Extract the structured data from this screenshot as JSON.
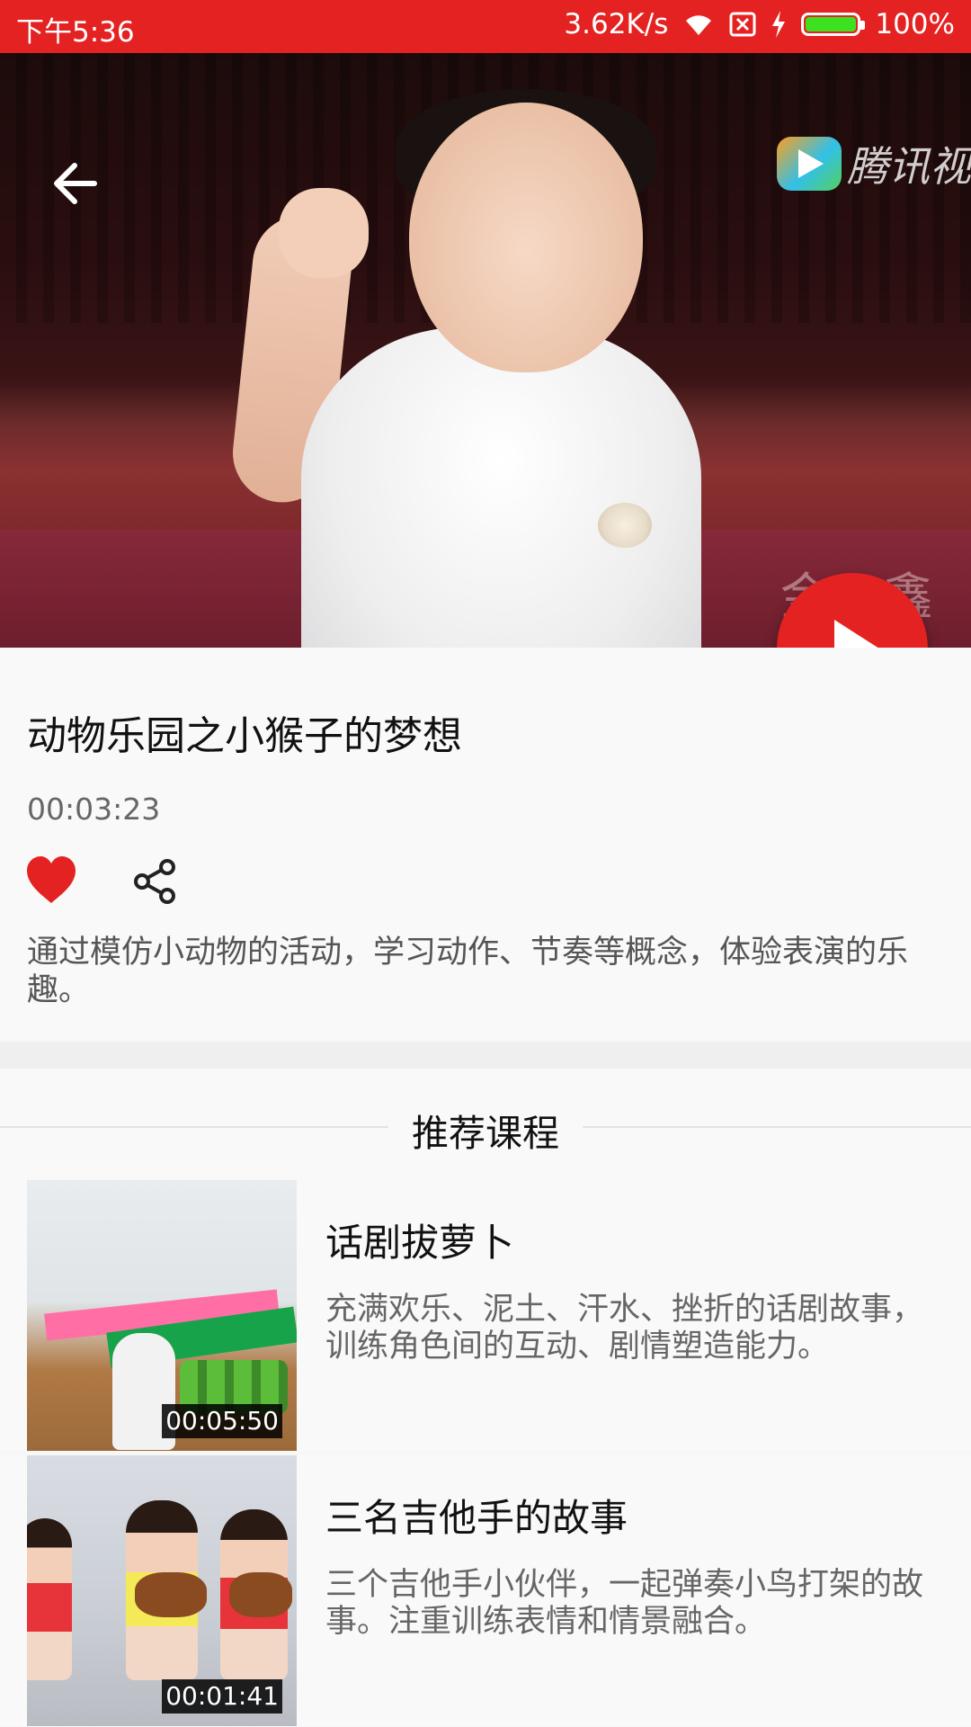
{
  "status_bar": {
    "time": "下午5:36",
    "speed": "3.62K/s",
    "battery": "100%",
    "color": "#e52222"
  },
  "hero": {
    "watermark_brand": "腾讯视",
    "watermark_overlay_1": "金 鑫",
    "watermark_overlay_2": "视",
    "icons": {
      "back": "arrow-left-icon",
      "play": "play-icon"
    }
  },
  "video": {
    "title": "动物乐园之小猴子的梦想",
    "duration": "00:03:23",
    "description": "通过模仿小动物的活动，学习动作、节奏等概念，体验表演的乐趣。",
    "icons": {
      "like": "heart-icon",
      "share": "share-icon"
    },
    "like_color": "#e52222"
  },
  "recommend": {
    "header": "推荐课程",
    "courses": [
      {
        "title": "话剧拔萝卜",
        "duration": "00:05:50",
        "description": "充满欢乐、泥土、汗水、挫折的话剧故事，训练角色间的互动、剧情塑造能力。"
      },
      {
        "title": "三名吉他手的故事",
        "duration": "00:01:41",
        "description": "三个吉他手小伙伴，一起弹奏小鸟打架的故事。注重训练表情和情景融合。"
      }
    ]
  }
}
